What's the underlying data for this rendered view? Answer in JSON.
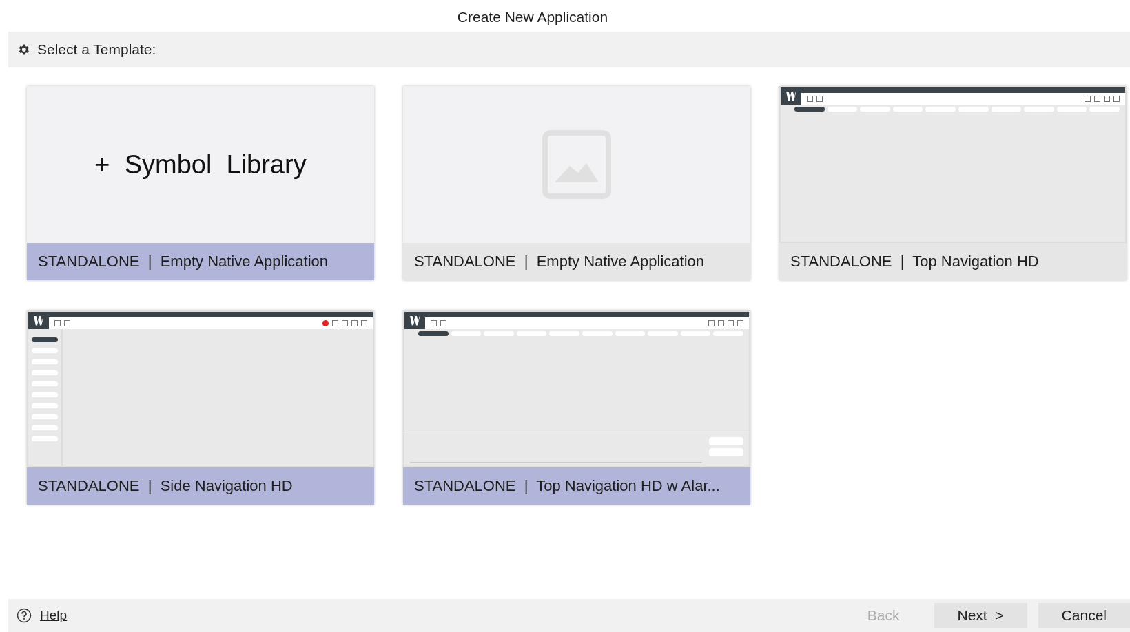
{
  "window": {
    "title": "Create New Application"
  },
  "header": {
    "label": "Select a Template:"
  },
  "templates": [
    {
      "kind": "symbol-library",
      "preview_text": "+  Symbol  Library",
      "label": "STANDALONE  |  Empty Native Application",
      "selected": true
    },
    {
      "kind": "image-placeholder",
      "label": "STANDALONE  |  Empty Native Application",
      "selected": false
    },
    {
      "kind": "top-nav",
      "label": "STANDALONE  |  Top Navigation HD",
      "selected": false
    },
    {
      "kind": "side-nav",
      "label": "STANDALONE  |  Side Navigation HD",
      "selected": true
    },
    {
      "kind": "top-nav-alarms",
      "label": "STANDALONE  |  Top Navigation HD w Alar...",
      "selected": true
    }
  ],
  "footer": {
    "help": "Help",
    "buttons": [
      {
        "label": "Back",
        "disabled": true
      },
      {
        "label": "Next  >",
        "disabled": false
      },
      {
        "label": "Cancel",
        "disabled": false
      }
    ]
  }
}
